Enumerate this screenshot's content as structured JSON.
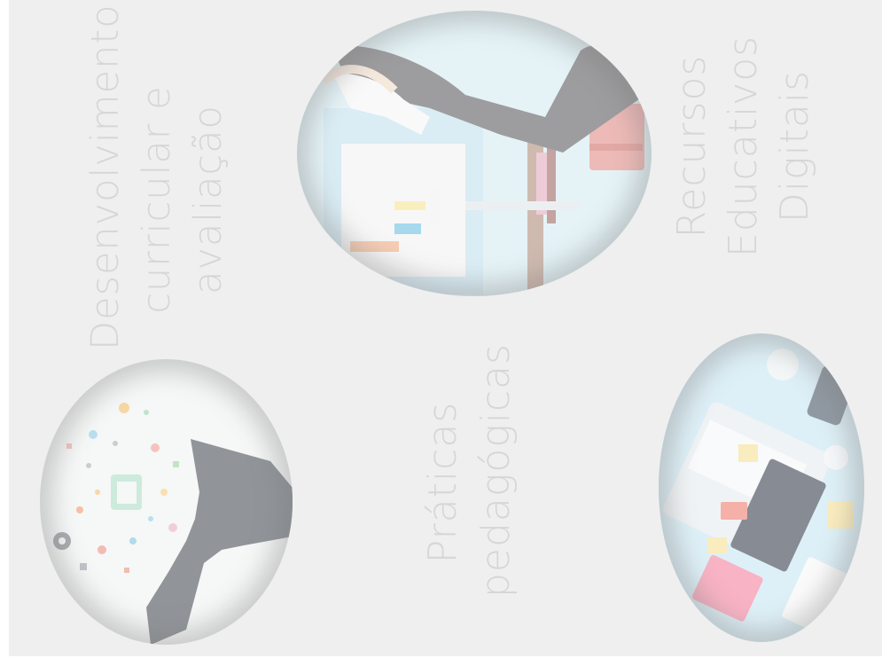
{
  "labels": {
    "desenvolvimento": [
      "Desenvolvimento",
      "curricular e",
      "avaliação"
    ],
    "recursos": [
      "Recursos",
      "Educativos",
      "Digitais"
    ],
    "praticas": [
      "Práticas",
      "pedagógicas"
    ]
  },
  "images": {
    "top": "office-desk-illustration-icon",
    "left": "head-with-ideas-illustration-icon",
    "right": "laptop-workspace-illustration-icon"
  },
  "colors": {
    "background": "#efefef",
    "label": "#d6d6d6"
  }
}
